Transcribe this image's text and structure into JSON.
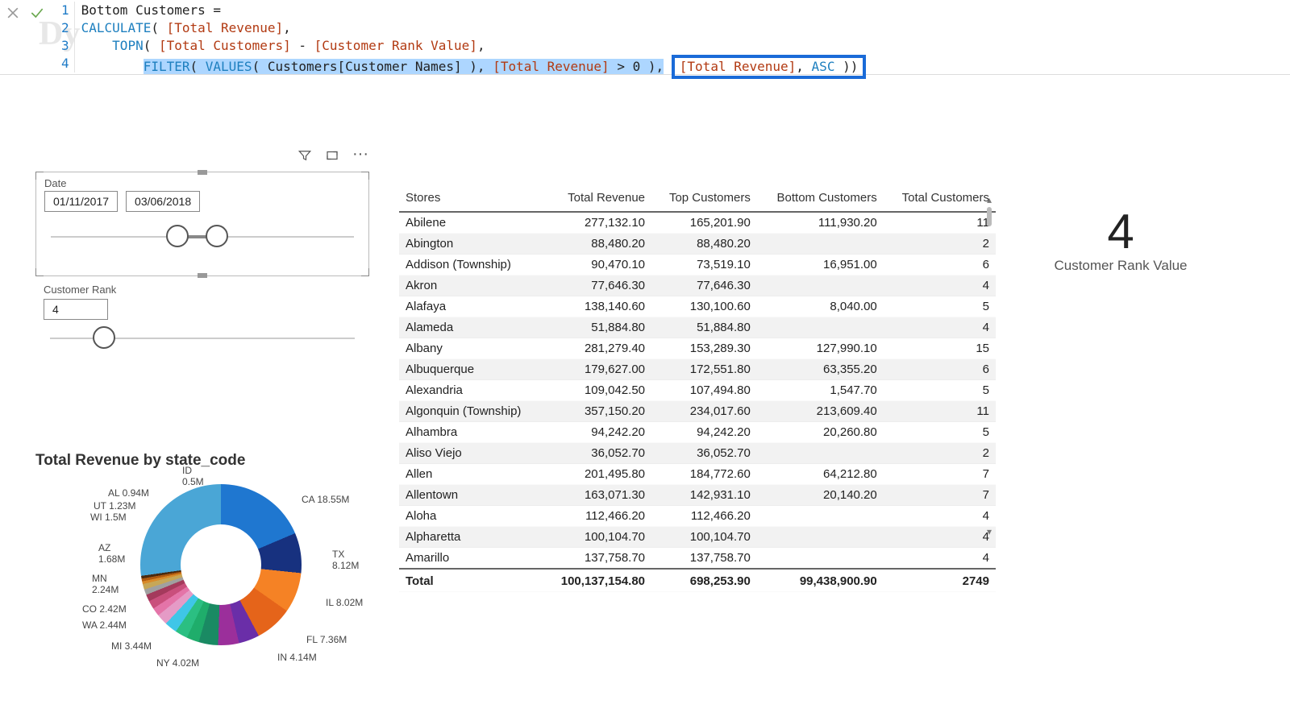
{
  "formula": {
    "icons": {
      "cancel": "close-icon",
      "commit": "check-icon"
    },
    "watermark": "Dy",
    "lines": {
      "l1": {
        "num": "1",
        "text": "Bottom Customers ="
      },
      "l2": {
        "num": "2",
        "func": "CALCULATE",
        "meas": "[Total Revenue]",
        "tail": ","
      },
      "l3": {
        "num": "3",
        "func": "TOPN",
        "m1": "[Total Customers]",
        "mid": " - ",
        "m2": "[Customer Rank Value]",
        "tail": ","
      },
      "l4": {
        "num": "4",
        "f1": "FILTER",
        "f2": "VALUES",
        "arg": "Customers[Customer Names]",
        "m1": "[Total Revenue]",
        "cmp": " > ",
        "zero": "0",
        "boxed_m": "[Total Revenue]",
        "boxed_kw": "ASC"
      }
    }
  },
  "actionbar": {
    "filter": "filter-icon",
    "focus": "focus-mode-icon",
    "more": "···"
  },
  "date_slicer": {
    "title": "Date",
    "from": "01/11/2017",
    "to": "03/06/2018"
  },
  "rank_slicer": {
    "title": "Customer Rank",
    "value": "4"
  },
  "card": {
    "value": "4",
    "label": "Customer Rank Value"
  },
  "donut": {
    "title": "Total Revenue by state_code",
    "labels": {
      "ca": "CA 18.55M",
      "tx_line1": "TX",
      "tx_line2": "8.12M",
      "il": "IL 8.02M",
      "fl": "FL 7.36M",
      "in": "IN 4.14M",
      "ny": "NY 4.02M",
      "mi": "MI 3.44M",
      "wa": "WA 2.44M",
      "co": "CO 2.42M",
      "mn_line1": "MN",
      "mn_line2": "2.24M",
      "az_line1": "AZ",
      "az_line2": "1.68M",
      "wi": "WI 1.5M",
      "ut": "UT 1.23M",
      "al": "AL 0.94M",
      "id_line1": "ID",
      "id_line2": "0.5M"
    }
  },
  "table": {
    "headers": {
      "c1": "Stores",
      "c2": "Total Revenue",
      "c3": "Top Customers",
      "c4": "Bottom Customers",
      "c5": "Total Customers"
    },
    "rows": [
      {
        "c1": "Abilene",
        "c2": "277,132.10",
        "c3": "165,201.90",
        "c4": "111,930.20",
        "c5": "11"
      },
      {
        "c1": "Abington",
        "c2": "88,480.20",
        "c3": "88,480.20",
        "c4": "",
        "c5": "2"
      },
      {
        "c1": "Addison (Township)",
        "c2": "90,470.10",
        "c3": "73,519.10",
        "c4": "16,951.00",
        "c5": "6"
      },
      {
        "c1": "Akron",
        "c2": "77,646.30",
        "c3": "77,646.30",
        "c4": "",
        "c5": "4"
      },
      {
        "c1": "Alafaya",
        "c2": "138,140.60",
        "c3": "130,100.60",
        "c4": "8,040.00",
        "c5": "5"
      },
      {
        "c1": "Alameda",
        "c2": "51,884.80",
        "c3": "51,884.80",
        "c4": "",
        "c5": "4"
      },
      {
        "c1": "Albany",
        "c2": "281,279.40",
        "c3": "153,289.30",
        "c4": "127,990.10",
        "c5": "15"
      },
      {
        "c1": "Albuquerque",
        "c2": "179,627.00",
        "c3": "172,551.80",
        "c4": "63,355.20",
        "c5": "6"
      },
      {
        "c1": "Alexandria",
        "c2": "109,042.50",
        "c3": "107,494.80",
        "c4": "1,547.70",
        "c5": "5"
      },
      {
        "c1": "Algonquin (Township)",
        "c2": "357,150.20",
        "c3": "234,017.60",
        "c4": "213,609.40",
        "c5": "11"
      },
      {
        "c1": "Alhambra",
        "c2": "94,242.20",
        "c3": "94,242.20",
        "c4": "20,260.80",
        "c5": "5"
      },
      {
        "c1": "Aliso Viejo",
        "c2": "36,052.70",
        "c3": "36,052.70",
        "c4": "",
        "c5": "2"
      },
      {
        "c1": "Allen",
        "c2": "201,495.80",
        "c3": "184,772.60",
        "c4": "64,212.80",
        "c5": "7"
      },
      {
        "c1": "Allentown",
        "c2": "163,071.30",
        "c3": "142,931.10",
        "c4": "20,140.20",
        "c5": "7"
      },
      {
        "c1": "Aloha",
        "c2": "112,466.20",
        "c3": "112,466.20",
        "c4": "",
        "c5": "4"
      },
      {
        "c1": "Alpharetta",
        "c2": "100,104.70",
        "c3": "100,104.70",
        "c4": "",
        "c5": "4"
      },
      {
        "c1": "Amarillo",
        "c2": "137,758.70",
        "c3": "137,758.70",
        "c4": "",
        "c5": "4"
      }
    ],
    "total": {
      "c1": "Total",
      "c2": "100,137,154.80",
      "c3": "698,253.90",
      "c4": "99,438,900.90",
      "c5": "2749"
    }
  },
  "chart_data": {
    "type": "pie",
    "title": "Total Revenue by state_code",
    "unit": "millions",
    "series": [
      {
        "name": "CA",
        "value": 18.55
      },
      {
        "name": "TX",
        "value": 8.12
      },
      {
        "name": "IL",
        "value": 8.02
      },
      {
        "name": "FL",
        "value": 7.36
      },
      {
        "name": "IN",
        "value": 4.14
      },
      {
        "name": "NY",
        "value": 4.02
      },
      {
        "name": "MI",
        "value": 3.44
      },
      {
        "name": "WA",
        "value": 2.44
      },
      {
        "name": "CO",
        "value": 2.42
      },
      {
        "name": "MN",
        "value": 2.24
      },
      {
        "name": "AZ",
        "value": 1.68
      },
      {
        "name": "WI",
        "value": 1.5
      },
      {
        "name": "UT",
        "value": 1.23
      },
      {
        "name": "AL",
        "value": 0.94
      },
      {
        "name": "ID",
        "value": 0.5
      }
    ]
  }
}
